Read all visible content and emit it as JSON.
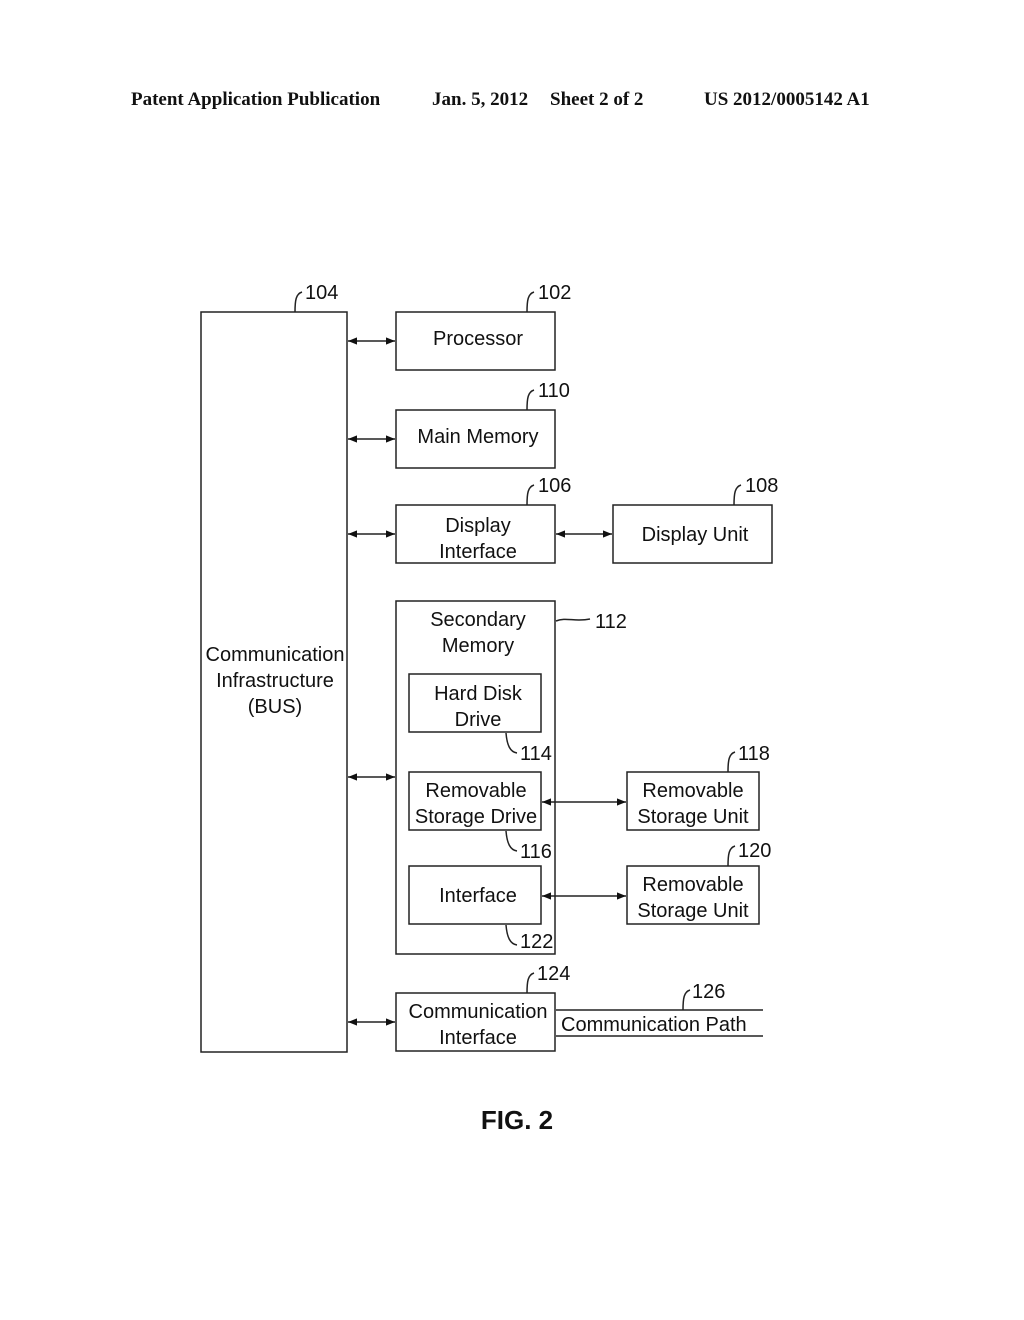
{
  "header": {
    "left": "Patent Application Publication",
    "date": "Jan. 5, 2012",
    "sheet": "Sheet 2 of 2",
    "number": "US 2012/0005142 A1"
  },
  "diagram": {
    "bus": {
      "ref": "104",
      "lines": [
        "Communication",
        "Infrastructure",
        "(BUS)"
      ]
    },
    "processor": {
      "ref": "102",
      "lines": [
        "Processor"
      ]
    },
    "main_memory": {
      "ref": "110",
      "lines": [
        "Main Memory"
      ]
    },
    "display_interface": {
      "ref": "106",
      "lines": [
        "Display",
        "Interface"
      ]
    },
    "display_unit": {
      "ref": "108",
      "lines": [
        "Display Unit"
      ]
    },
    "secondary_memory": {
      "ref": "112",
      "lines": [
        "Secondary",
        "Memory"
      ]
    },
    "hard_disk_drive": {
      "ref": "114",
      "lines": [
        "Hard Disk",
        "Drive"
      ]
    },
    "removable_storage_drive": {
      "ref": "116",
      "lines": [
        "Removable",
        "Storage Drive"
      ]
    },
    "removable_storage_unit_1": {
      "ref": "118",
      "lines": [
        "Removable",
        "Storage Unit"
      ]
    },
    "interface": {
      "ref": "122",
      "lines": [
        "Interface"
      ]
    },
    "removable_storage_unit_2": {
      "ref": "120",
      "lines": [
        "Removable",
        "Storage Unit"
      ]
    },
    "communication_interface": {
      "ref": "124",
      "lines": [
        "Communication",
        "Interface"
      ]
    },
    "communication_path": {
      "ref": "126",
      "lines": [
        "Communication Path"
      ]
    }
  },
  "figure_label": "FIG. 2"
}
